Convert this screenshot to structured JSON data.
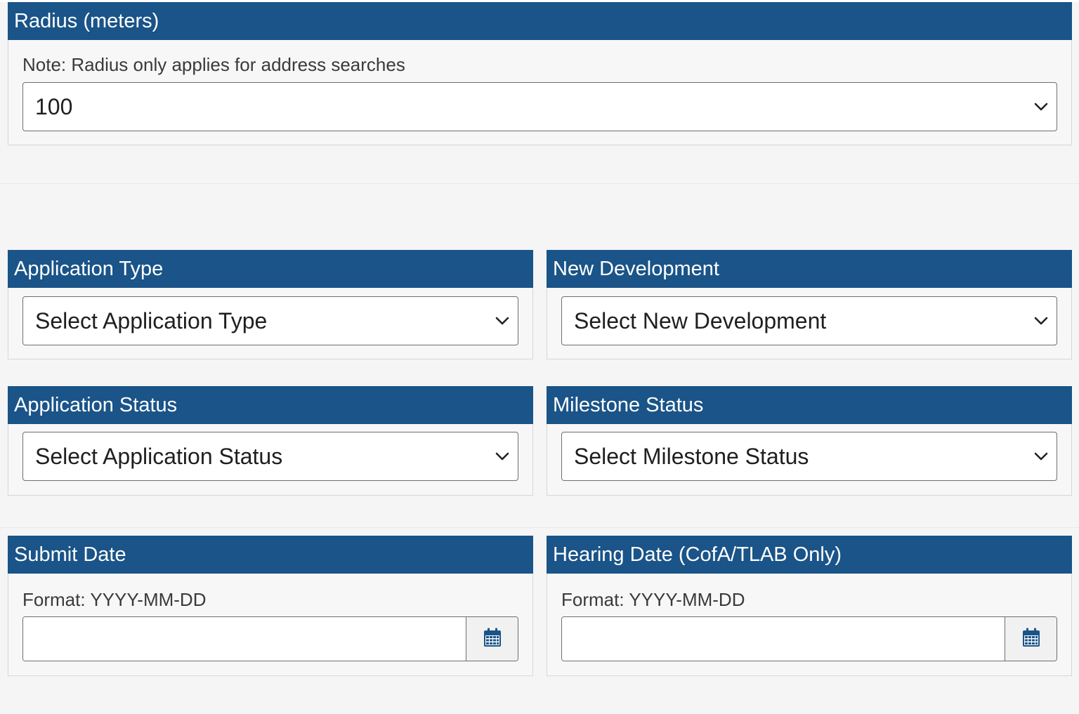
{
  "radius": {
    "title": "Radius (meters)",
    "note": "Note: Radius only applies for address searches",
    "selected": "100"
  },
  "application_type": {
    "title": "Application Type",
    "selected": "Select Application Type"
  },
  "new_development": {
    "title": "New Development",
    "selected": "Select New Development"
  },
  "application_status": {
    "title": "Application Status",
    "selected": "Select Application Status"
  },
  "milestone_status": {
    "title": "Milestone Status",
    "selected": "Select Milestone Status"
  },
  "submit_date": {
    "title": "Submit Date",
    "note": "Format: YYYY-MM-DD",
    "value": ""
  },
  "hearing_date": {
    "title": "Hearing Date (CofA/TLAB Only)",
    "note": "Format: YYYY-MM-DD",
    "value": ""
  },
  "icons": {
    "dropdown": "chevron-down-icon",
    "calendar": "calendar-icon"
  },
  "colors": {
    "header_bg": "#1a5488",
    "header_text": "#ffffff",
    "page_bg": "#f5f5f5"
  }
}
